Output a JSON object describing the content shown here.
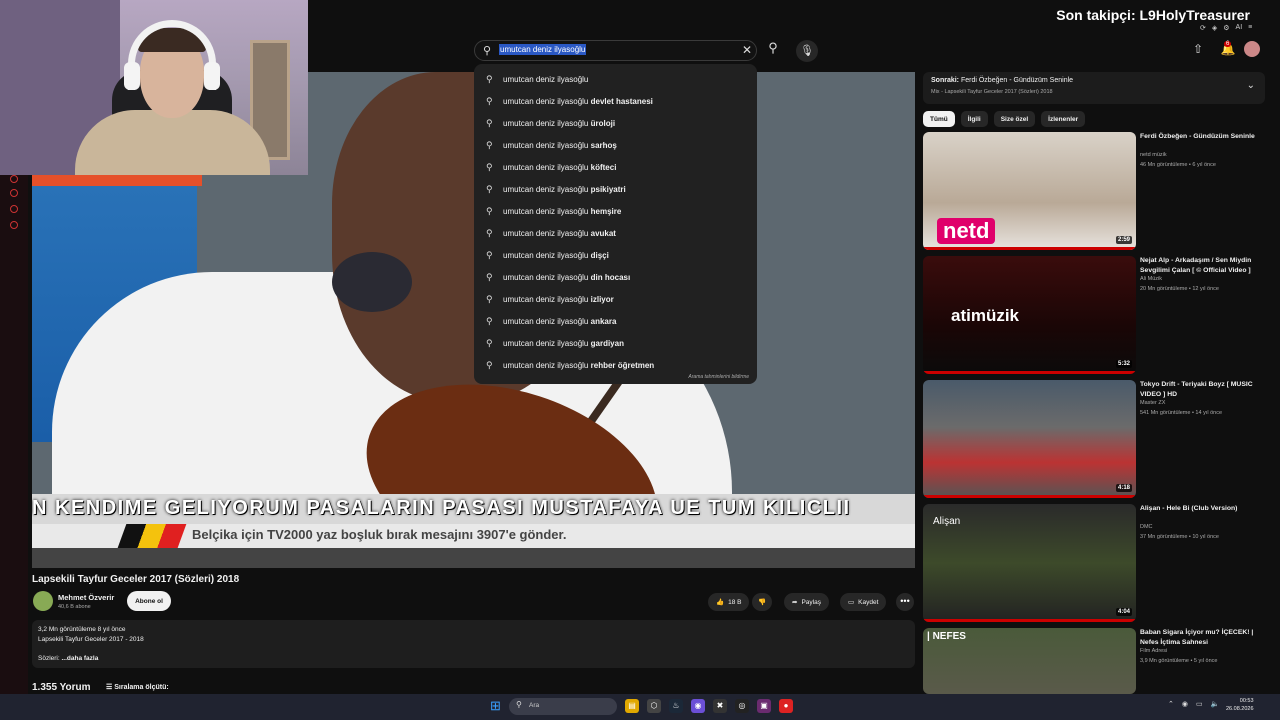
{
  "overlay": {
    "follower_text": "Son takipçi: L9HolyTreasurer"
  },
  "search": {
    "query": "umutcan deniz ilyasoğlu",
    "suggestions": [
      {
        "prefix": "umutcan deniz ilyasoğlu",
        "suffix": ""
      },
      {
        "prefix": "umutcan deniz ilyasoğlu",
        "suffix": "devlet hastanesi"
      },
      {
        "prefix": "umutcan deniz ilyasoğlu",
        "suffix": "üroloji"
      },
      {
        "prefix": "umutcan deniz ilyasoğlu",
        "suffix": "sarhoş"
      },
      {
        "prefix": "umutcan deniz ilyasoğlu",
        "suffix": "köfteci"
      },
      {
        "prefix": "umutcan deniz ilyasoğlu",
        "suffix": "psikiyatri"
      },
      {
        "prefix": "umutcan deniz ilyasoğlu",
        "suffix": "hemşire"
      },
      {
        "prefix": "umutcan deniz ilyasoğlu",
        "suffix": "avukat"
      },
      {
        "prefix": "umutcan deniz ilyasoğlu",
        "suffix": "dişçi"
      },
      {
        "prefix": "umutcan deniz ilyasoğlu",
        "suffix": "din hocası"
      },
      {
        "prefix": "umutcan deniz ilyasoğlu",
        "suffix": "izliyor"
      },
      {
        "prefix": "umutcan deniz ilyasoğlu",
        "suffix": "ankara"
      },
      {
        "prefix": "umutcan deniz ilyasoğlu",
        "suffix": "gardiyan"
      },
      {
        "prefix": "umutcan deniz ilyasoğlu",
        "suffix": "rehber öğretmen"
      }
    ],
    "report_label": "Arama tahminlerini bildirme"
  },
  "header": {
    "notification_count": "6"
  },
  "video": {
    "ticker": "N KENDIME GELIYORUM PASALARIN PASASI MUSTAFAYA UE TUM KILICLII",
    "subtitle": "Belçika için TV2000 yaz boşluk bırak mesajını 3907'e gönder.",
    "title": "Lapsekili Tayfur Geceler 2017 (Sözleri) 2018",
    "channel": "Mehmet Özverir",
    "subscribers": "40,6 B abone",
    "subscribe_label": "Abone ol",
    "likes": "18 B",
    "share_label": "Paylaş",
    "save_label": "Kaydet",
    "more_label": "•••",
    "description": {
      "stats": "3,2 Mn görüntüleme  8 yıl önce",
      "line": "Lapsekili Tayfur Geceler 2017 - 2018",
      "lyrics_label": "Sözleri",
      "more": "...daha fazla"
    },
    "comments_count": "1.355 Yorum",
    "sort_label": "Sıralama ölçütü:"
  },
  "queue": {
    "next_label": "Sonraki:",
    "next_title": "Ferdi Özbeğen - Gündüzüm Seninle",
    "mix_text": "Mix - Lapsekili Tayfur Geceler 2017 (Sözleri) 2018"
  },
  "chips": [
    "Tümü",
    "İlgili",
    "Size özel",
    "İzlenenler"
  ],
  "recommendations": [
    {
      "title": "Ferdi Özbeğen - Gündüzüm Seninle",
      "channel": "netd müzik",
      "meta": "46 Mn görüntüleme • 6 yıl önce",
      "duration": "2:59",
      "logo": "netd"
    },
    {
      "title": "Nejat Alp - Arkadaşım / Sen Miydin Sevgilimi Çalan [ © Official Video ]",
      "channel": "Ali Müzik",
      "meta": "20 Mn görüntüleme • 12 yıl önce",
      "duration": "5:32",
      "logo": "atimüzik"
    },
    {
      "title": "Tokyo Drift - Teriyaki Boyz [ MUSIC VIDEO ] HD",
      "channel": "Master ZX",
      "meta": "541 Mn görüntüleme • 14 yıl önce",
      "duration": "4:18",
      "logo": ""
    },
    {
      "title": "Alişan - Hele Bi (Club Version)",
      "channel": "DMC",
      "meta": "37 Mn görüntüleme • 10 yıl önce",
      "duration": "4:04",
      "logo": "Alişan"
    },
    {
      "title": "Baban Sigara İçiyor mu? İÇECEK! | Nefes İçtima Sahnesi",
      "channel": "Film Adresi",
      "meta": "3,9 Mn görüntüleme • 5 yıl önce",
      "duration": "",
      "logo": "| NEFES"
    }
  ],
  "taskbar": {
    "search_placeholder": "Ara",
    "time": "00:53",
    "date": "26.08.2026"
  }
}
